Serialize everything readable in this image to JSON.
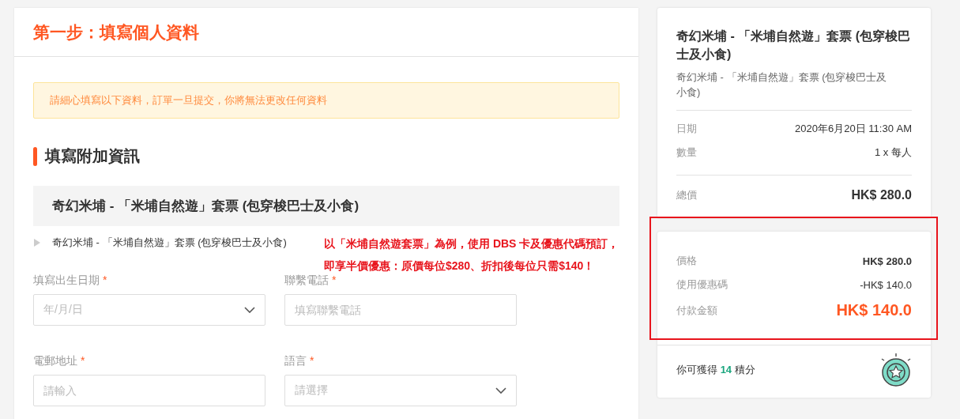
{
  "step_title": "第一步：填寫個人資料",
  "notice": "請細心填寫以下資料，訂單一旦提交，你將無法更改任何資料",
  "section_title": "填寫附加資訊",
  "product_bar": "奇幻米埔 - 「米埔自然遊」套票 (包穿梭巴士及小食)",
  "product_item": {
    "label": "奇幻米埔 - 「米埔自然遊」套票 (包穿梭巴士及小食)",
    "expanded": false
  },
  "fields": [
    {
      "label": "填寫出生日期",
      "required": "*",
      "kind": "select",
      "placeholder": "年/月/日"
    },
    {
      "label": "聯繫電話",
      "required": "*",
      "kind": "text",
      "placeholder": "填寫聯繫電話"
    },
    {
      "label": "電郵地址",
      "required": "*",
      "kind": "text",
      "placeholder": "請輸入"
    },
    {
      "label": "語言",
      "required": "*",
      "kind": "select",
      "placeholder": "請選擇"
    }
  ],
  "annotation": [
    "以「米埔自然遊套票」為例，使用 DBS 卡及優惠代碼預訂，",
    "即享半價優惠：原價每位$280、折扣後每位只需$140！"
  ],
  "summary": {
    "title": "奇幻米埔 - 「米埔自然遊」套票 (包穿梭巴士及小食)",
    "subtitle": "奇幻米埔 - 「米埔自然遊」套票 (包穿梭巴士及小食)",
    "details": [
      {
        "label": "日期",
        "value": "2020年6月20日 11:30 AM"
      },
      {
        "label": "數量",
        "value": "1 x 每人"
      }
    ],
    "total": {
      "label": "總價",
      "value": "HK$ 280.0"
    },
    "payment": [
      {
        "label": "價格",
        "value": "HK$ 280.0",
        "kind": "bold"
      },
      {
        "label": "使用優惠碼",
        "value": "-HK$ 140.0",
        "kind": "plain"
      },
      {
        "label": "付款金額",
        "value": "HK$ 140.0",
        "kind": "pay"
      }
    ],
    "points": {
      "prefix": "你可獲得",
      "amount": "14",
      "suffix": "積分"
    }
  }
}
